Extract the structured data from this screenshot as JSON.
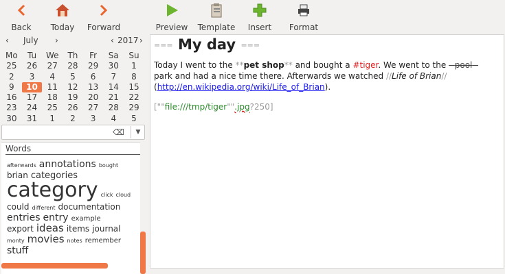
{
  "toolbar": {
    "back": "Back",
    "today": "Today",
    "forward": "Forward",
    "preview": "Preview",
    "template": "Template",
    "insert": "Insert",
    "format": "Format"
  },
  "calendar": {
    "month": "July",
    "year": "2017",
    "weekdays": [
      "Mo",
      "Tu",
      "We",
      "Th",
      "Fr",
      "Sa",
      "Su"
    ],
    "weeks": [
      [
        "25",
        "26",
        "27",
        "28",
        "29",
        "30",
        "1"
      ],
      [
        "2",
        "3",
        "4",
        "5",
        "6",
        "7",
        "8"
      ],
      [
        "9",
        "10",
        "11",
        "12",
        "13",
        "14",
        "15"
      ],
      [
        "16",
        "17",
        "18",
        "19",
        "20",
        "21",
        "22"
      ],
      [
        "23",
        "24",
        "25",
        "26",
        "27",
        "28",
        "29"
      ],
      [
        "30",
        "31",
        "1",
        "2",
        "3",
        "4",
        "5"
      ]
    ],
    "selected_day": "10"
  },
  "search": {
    "value": "",
    "placeholder": ""
  },
  "cloud": {
    "title": "Words",
    "lines": [
      [
        {
          "w": "afterwards",
          "s": 8
        },
        {
          "w": "annotations",
          "s": 14
        },
        {
          "w": "bought",
          "s": 8
        }
      ],
      [
        {
          "w": "brian",
          "s": 12
        },
        {
          "w": "categories",
          "s": 13
        }
      ],
      [
        {
          "w": "category",
          "s": 30
        },
        {
          "w": "click",
          "s": 8
        },
        {
          "w": "cloud",
          "s": 8
        }
      ],
      [
        {
          "w": "could",
          "s": 12
        },
        {
          "w": "different",
          "s": 8
        },
        {
          "w": "documentation",
          "s": 12
        }
      ],
      [
        {
          "w": "entries",
          "s": 14
        },
        {
          "w": "entry",
          "s": 14
        },
        {
          "w": "example",
          "s": 10
        }
      ],
      [
        {
          "w": "export",
          "s": 12
        },
        {
          "w": "ideas",
          "s": 15
        },
        {
          "w": "items",
          "s": 12
        },
        {
          "w": "journal",
          "s": 12
        }
      ],
      [
        {
          "w": "monty",
          "s": 8
        },
        {
          "w": "movies",
          "s": 15
        },
        {
          "w": "notes",
          "s": 8
        },
        {
          "w": "remember",
          "s": 10
        }
      ],
      [
        {
          "w": "stuff",
          "s": 14
        }
      ]
    ]
  },
  "editor": {
    "title_marker_open": "===",
    "title": "My day",
    "title_marker_close": "===",
    "p1_a": "Today I went to the ",
    "bold_marker": "**",
    "bold_text": "pet shop",
    "p1_b": " and bought a ",
    "tag": "#tiger",
    "p1_c": ". We went to the ",
    "strike_marker": "--",
    "strike_text": "pool",
    "p1_d": " park and had a nice time there. Afterwards we watched ",
    "italic_marker": "//",
    "italic_text": "Life of Brian",
    "p1_e": " (",
    "link": "http://en.wikipedia.org/wiki/Life_of_Brian",
    "p1_f": ").",
    "img_open": "[\"\"",
    "img_url": "file:///tmp/tiger",
    "img_quote": "\"\"",
    "img_ext": ".jpg",
    "img_size": "?250]"
  },
  "colors": {
    "accent": "#f07746",
    "link": "#1a1af0",
    "tag": "#dd2222"
  }
}
